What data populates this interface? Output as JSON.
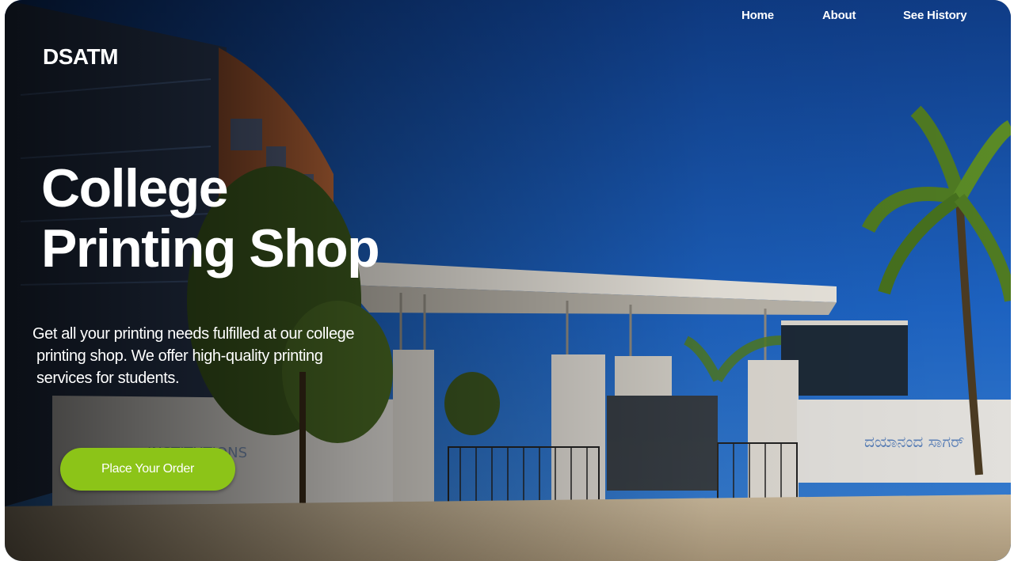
{
  "nav": {
    "items": [
      {
        "label": "Home"
      },
      {
        "label": "About"
      },
      {
        "label": "See History"
      }
    ]
  },
  "brand": "DSATM",
  "hero": {
    "title_line1": "College",
    "title_line2": "Printing Shop",
    "description_lines": [
      "Get all your printing needs fulfilled at our college",
      "printing shop. We offer high-quality printing",
      "services for students."
    ],
    "cta_label": "Place Your Order"
  },
  "colors": {
    "accent": "#8cc418",
    "sky": "#1f5fb8"
  }
}
